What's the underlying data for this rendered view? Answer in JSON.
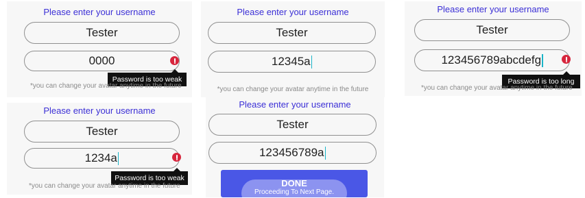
{
  "panels": [
    {
      "prompt": "Please enter your username",
      "username": "Tester",
      "password": "0000",
      "has_caret": false,
      "error": "Password is too weak",
      "hint": "*you can change your avatar anytime in the future"
    },
    {
      "prompt": "Please enter your username",
      "username": "Tester",
      "password": "12345a",
      "has_caret": true,
      "error": "",
      "hint": "*you can change your avatar anytime in the future"
    },
    {
      "prompt": "Please enter your username",
      "username": "Tester",
      "password": "123456789abcdefg",
      "has_caret": true,
      "error": "Password is too long",
      "hint": "*you can change your avatar anytime in the future"
    },
    {
      "prompt": "Please enter your username",
      "username": "Tester",
      "password": "1234a",
      "has_caret": true,
      "error": "Password is too weak",
      "hint": "*you can change your avatar anytime in the future"
    },
    {
      "prompt": "Please enter your username",
      "username": "Tester",
      "password": "123456789a",
      "has_caret": true,
      "error": "",
      "done_button": {
        "label": "DONE",
        "subtext": "Proceeding To Next Page."
      }
    }
  ],
  "colors": {
    "prompt": "#3b2fd6",
    "error_icon": "#d7263d",
    "caret": "#19b4c8",
    "done_button": "#4a57e6"
  },
  "icons": {
    "error": "exclamation-circle-icon"
  }
}
